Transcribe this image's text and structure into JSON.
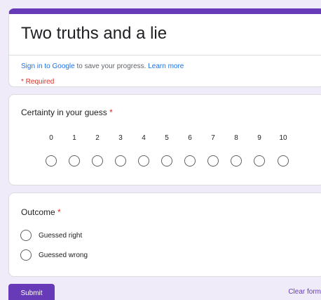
{
  "header": {
    "title": "Two truths and a lie",
    "signin_link": "Sign in to Google",
    "signin_text": " to save your progress. ",
    "learn_more": "Learn more",
    "required_note": "* Required"
  },
  "question1": {
    "title": "Certainty in your guess",
    "required_marker": "*",
    "scale": [
      "0",
      "1",
      "2",
      "3",
      "4",
      "5",
      "6",
      "7",
      "8",
      "9",
      "10"
    ]
  },
  "question2": {
    "title": "Outcome",
    "required_marker": "*",
    "options": [
      "Guessed right",
      "Guessed wrong"
    ]
  },
  "actions": {
    "submit_label": "Submit",
    "clear_label": "Clear form"
  },
  "colors": {
    "accent": "#673ab7",
    "page_background": "#f0ebf8",
    "required": "#d93025",
    "link": "#1a73e8"
  }
}
